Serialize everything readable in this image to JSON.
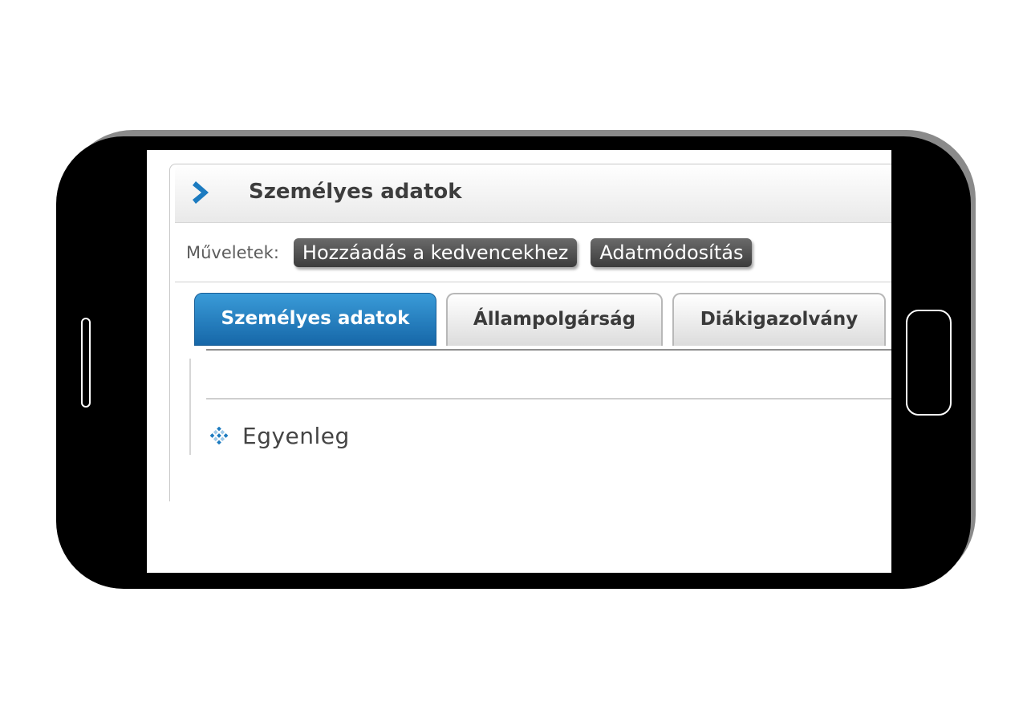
{
  "header": {
    "title": "Személyes adatok",
    "chevron_icon": "chevron-right-icon"
  },
  "actions": {
    "label": "Műveletek:",
    "buttons": [
      {
        "label": "Hozzáadás a kedvencekhez"
      },
      {
        "label": "Adatmódosítás"
      }
    ]
  },
  "tabs": [
    {
      "label": "Személyes adatok",
      "active": true
    },
    {
      "label": "Állampolgárság",
      "active": false
    },
    {
      "label": "Diákigazolvány",
      "active": false
    }
  ],
  "content": {
    "items": [
      {
        "label": "Egyenleg",
        "icon": "diamond-bullet-icon"
      }
    ]
  },
  "colors": {
    "accent": "#1c7bc0",
    "phone_body": "#000000",
    "button_dark": "#4a4a4a"
  }
}
